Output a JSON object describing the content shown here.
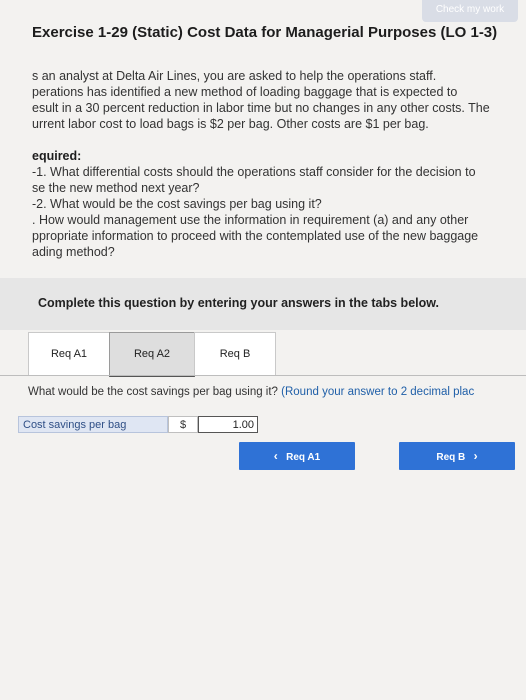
{
  "check_button_label": "Check my work",
  "title": "Exercise 1-29 (Static) Cost Data for Managerial Purposes (LO 1-3)",
  "intro_lines": [
    "s an analyst at Delta Air Lines, you are asked to help the operations staff.",
    "perations has identified a new method of loading baggage that is expected to",
    "esult in a 30 percent reduction in labor time but no changes in any other costs. The",
    "urrent labor cost to load bags is $2 per bag. Other costs are $1 per bag."
  ],
  "required": {
    "heading": "equired:",
    "lines": [
      "-1. What differential costs should the operations staff consider for the decision to",
      "se the new method next year?",
      "-2. What would be the cost savings per bag using it?",
      ". How would management use the information in requirement (a) and any other",
      "ppropriate information to proceed with the contemplated use of the new baggage",
      "ading method?"
    ]
  },
  "panel_title": "Complete this question by entering your answers in the tabs below.",
  "tabs": [
    {
      "label": "Req A1",
      "active": false
    },
    {
      "label": "Req A2",
      "active": true
    },
    {
      "label": "Req B",
      "active": false
    }
  ],
  "question": {
    "text": "What would be the cost savings per bag using it?",
    "hint": "(Round your answer to 2 decimal plac"
  },
  "answer": {
    "label": "Cost savings per bag",
    "currency": "$",
    "value": "1.00"
  },
  "nav": {
    "prev_label": "Req A1",
    "next_label": "Req B"
  },
  "colors": {
    "accent": "#2f72d6",
    "link": "#1f5fa8"
  }
}
